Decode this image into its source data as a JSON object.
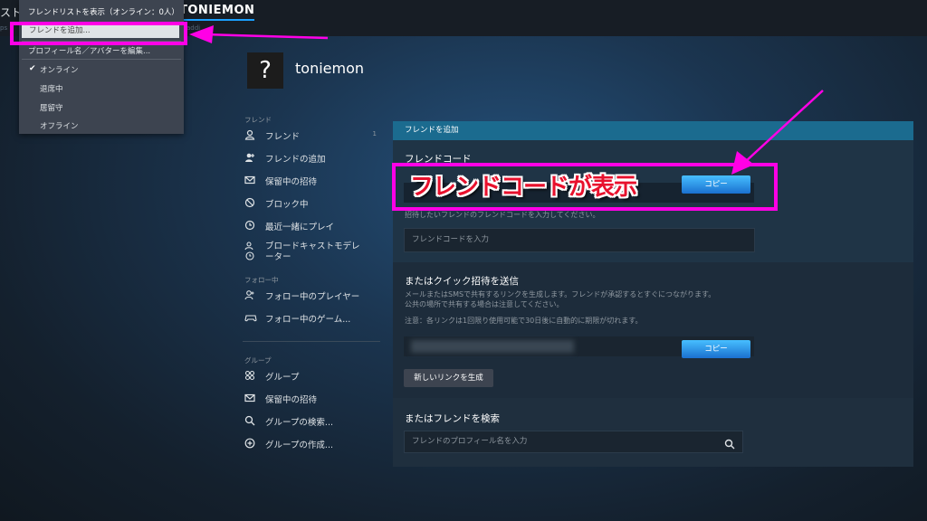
{
  "topbar": {
    "store": "スト",
    "username": "TONIEMON",
    "sub": "ps",
    "sub_right": "addi"
  },
  "dropdown": {
    "header": "フレンドリストを表示（オンライン：0人）",
    "items": [
      "フレンドを追加...",
      "プロフィール名／アバターを編集...",
      "オンライン",
      "退席中",
      "居留守",
      "オフライン"
    ],
    "check": "✔"
  },
  "profile": {
    "avatar": "?",
    "name": "toniemon"
  },
  "sidebar": {
    "sec_friends": "フレンド",
    "friends": [
      "フレンド",
      "フレンドの追加",
      "保留中の招待",
      "ブロック中",
      "最近一緒にプレイ",
      "ブロードキャストモデレーター"
    ],
    "friends_badge": "1",
    "sec_following": "フォロー中",
    "following": [
      "フォロー中のプレイヤー",
      "フォロー中のゲーム..."
    ],
    "sec_groups": "グループ",
    "groups": [
      "グループ",
      "保留中の招待",
      "グループの検索...",
      "グループの作成..."
    ]
  },
  "panel": {
    "header": "フレンドを追加",
    "friend_code_title": "フレンドコード",
    "copy_label": "コピー",
    "code_hint": "招待したいフレンドのフレンドコードを入力してください。",
    "code_input_placeholder": "フレンドコードを入力",
    "quick_title": "またはクイック招待を送信",
    "quick_desc1": "メールまたはSMSで共有するリンクを生成します。フレンドが承認するとすぐにつながります。",
    "quick_desc2": "公共の場所で共有する場合は注意してください。",
    "quick_note": "注意：各リンクは1回限り使用可能で30日後に自動的に期限が切れます。",
    "copy_label2": "コピー",
    "new_link": "新しいリンクを生成",
    "search_title": "またはフレンドを検索",
    "search_placeholder": "フレンドのプロフィール名を入力"
  },
  "annotation": {
    "overlay_text": "フレンドコードが表示"
  },
  "colors": {
    "accent": "#1a9fff",
    "highlight": "#ff00e6",
    "overlay_text": "#e8112d"
  }
}
